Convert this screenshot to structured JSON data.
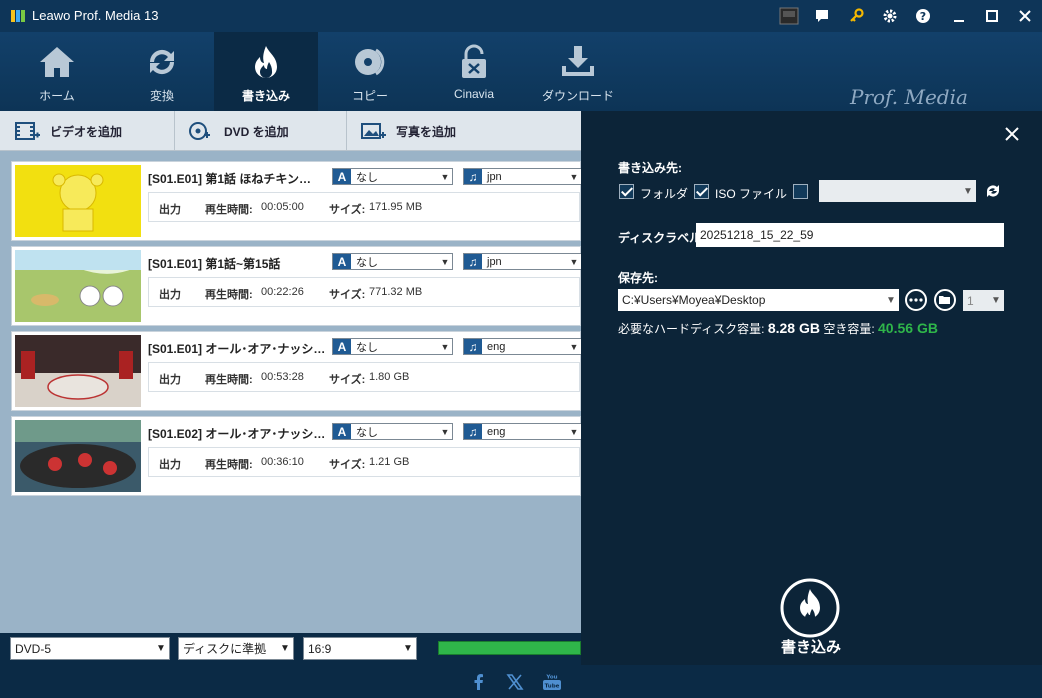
{
  "window": {
    "title": "Leawo Prof. Media 13"
  },
  "titlebar_icons": [
    "amd-icon",
    "chat-icon",
    "key-icon",
    "gear-icon",
    "help-icon",
    "minimize-icon",
    "maximize-icon",
    "close-icon"
  ],
  "nav": [
    {
      "label": "ホーム",
      "icon": "home-icon"
    },
    {
      "label": "変換",
      "icon": "convert-icon"
    },
    {
      "label": "書き込み",
      "icon": "burn-icon",
      "active": true
    },
    {
      "label": "コピー",
      "icon": "copy-disc-icon"
    },
    {
      "label": "Cinavia",
      "icon": "cinavia-lock-icon"
    },
    {
      "label": "ダウンロード",
      "icon": "download-icon"
    }
  ],
  "brand": "Prof. Media",
  "toolbar": {
    "add_video": "ビデオを追加",
    "add_dvd": "DVD を追加",
    "add_photo": "写真を追加"
  },
  "labels": {
    "output": "出力",
    "duration": "再生時間:",
    "size": "サイズ:"
  },
  "items": [
    {
      "title": "[S01.E01] 第1話 ほねチキン…",
      "subtitle": "なし",
      "audio": "jpn",
      "duration": "00:05:00",
      "size": "171.95 MB"
    },
    {
      "title": "[S01.E01] 第1話~第15話",
      "subtitle": "なし",
      "audio": "jpn",
      "duration": "00:22:26",
      "size": "771.32 MB"
    },
    {
      "title": "[S01.E01] オール･オア･ナッシ…",
      "subtitle": "なし",
      "audio": "eng",
      "duration": "00:53:28",
      "size": "1.80 GB"
    },
    {
      "title": "[S01.E02] オール･オア･ナッシ…",
      "subtitle": "なし",
      "audio": "eng",
      "duration": "00:36:10",
      "size": "1.21 GB"
    }
  ],
  "bottom": {
    "disc_type": "DVD-5",
    "quality": "ディスクに準拠",
    "aspect": "16:9",
    "progress": 1.0
  },
  "panel": {
    "burn_to_label": "書き込み先:",
    "folder_label": "フォルダ",
    "folder_checked": true,
    "iso_label": "ISO ファイル",
    "iso_checked": true,
    "disc_checked": false,
    "disc_label_label": "ディスクラベル:",
    "disc_label_value": "20251218_15_22_59",
    "save_to_label": "保存先:",
    "save_path": "C:¥Users¥Moyea¥Desktop",
    "copies": "1",
    "required_label": "必要なハードディスク容量:",
    "required_value": "8.28 GB",
    "free_label": "空き容量:",
    "free_value": "40.56 GB",
    "burn_button": "書き込み"
  },
  "footer_icons": [
    "facebook-icon",
    "x-icon",
    "youtube-icon"
  ],
  "colors": {
    "accent_green": "#2fb64a",
    "panel_bg": "#0c2438",
    "nav_bg": "#12406a"
  }
}
